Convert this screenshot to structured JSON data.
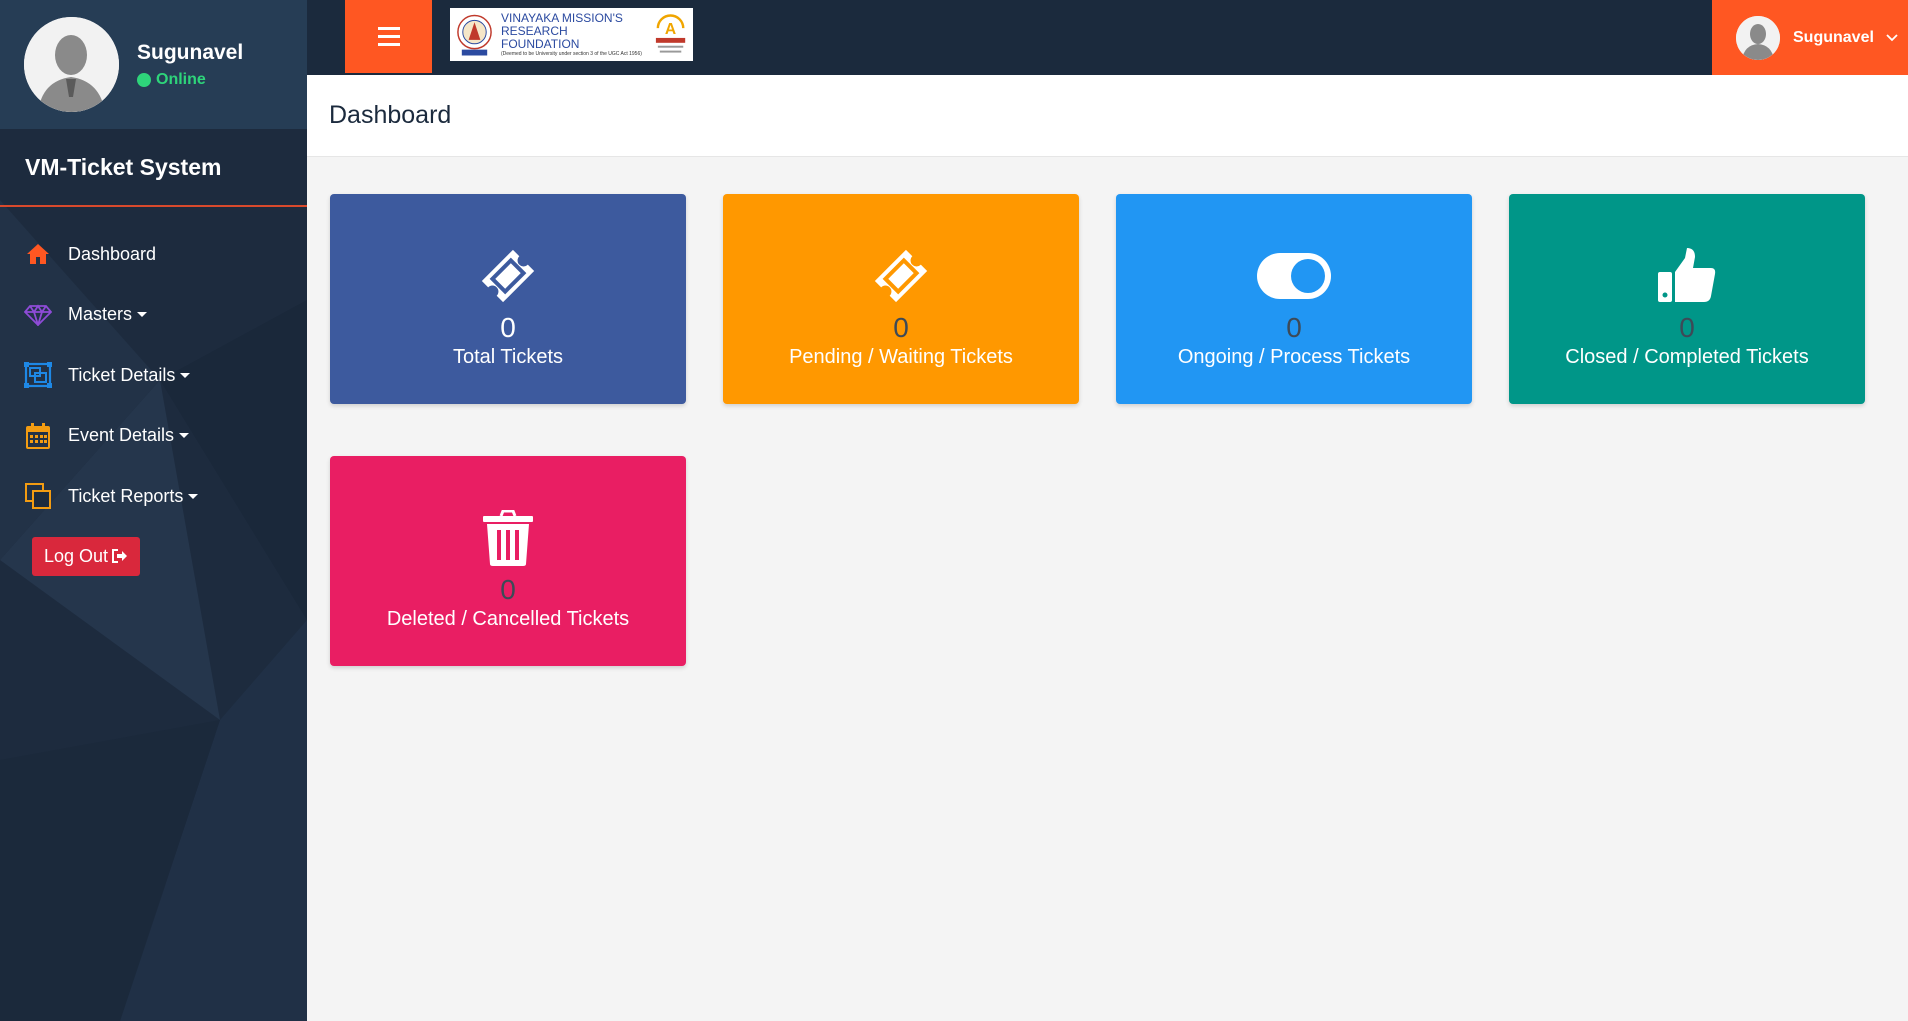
{
  "sidebar": {
    "user": {
      "name": "Sugunavel",
      "status": "Online"
    },
    "brand": "VM-Ticket System",
    "menu": [
      {
        "label": "Dashboard",
        "icon": "home-icon",
        "dropdown": false
      },
      {
        "label": "Masters",
        "icon": "diamond-icon",
        "dropdown": true
      },
      {
        "label": "Ticket Details",
        "icon": "object-group-icon",
        "dropdown": true
      },
      {
        "label": "Event Details",
        "icon": "calendar-icon",
        "dropdown": true
      },
      {
        "label": "Ticket Reports",
        "icon": "clone-icon",
        "dropdown": true
      }
    ],
    "logout": "Log Out"
  },
  "topbar": {
    "logo": {
      "line1": "VINAYAKA MISSION'S",
      "line2": "RESEARCH FOUNDATION",
      "line3": "(Deemed to be University under section 3 of the UGC Act 1956)",
      "grade": "A"
    },
    "user_name": "Sugunavel"
  },
  "content": {
    "title": "Dashboard",
    "cards": [
      {
        "count": "0",
        "label": "Total Tickets",
        "icon": "ticket-icon",
        "color": "#3d5a9e",
        "count_color": "#ffffff"
      },
      {
        "count": "0",
        "label": "Pending / Waiting Tickets",
        "icon": "ticket-icon",
        "color": "#ff9800",
        "count_color": "#3d4a57"
      },
      {
        "count": "0",
        "label": "Ongoing / Process Tickets",
        "icon": "toggle-on-icon",
        "color": "#2196f3",
        "count_color": "#3d4a57"
      },
      {
        "count": "0",
        "label": "Closed / Completed Tickets",
        "icon": "thumbs-up-icon",
        "color": "#009688",
        "count_color": "#3d4a57"
      },
      {
        "count": "0",
        "label": "Deleted / Cancelled Tickets",
        "icon": "trash-icon",
        "color": "#e91e63",
        "count_color": "#3d4a57"
      }
    ]
  },
  "colors": {
    "accent": "#ff5722",
    "sidebar_bg": "#1d2b3e",
    "online": "#2ed47a",
    "logout": "#d9283c"
  }
}
